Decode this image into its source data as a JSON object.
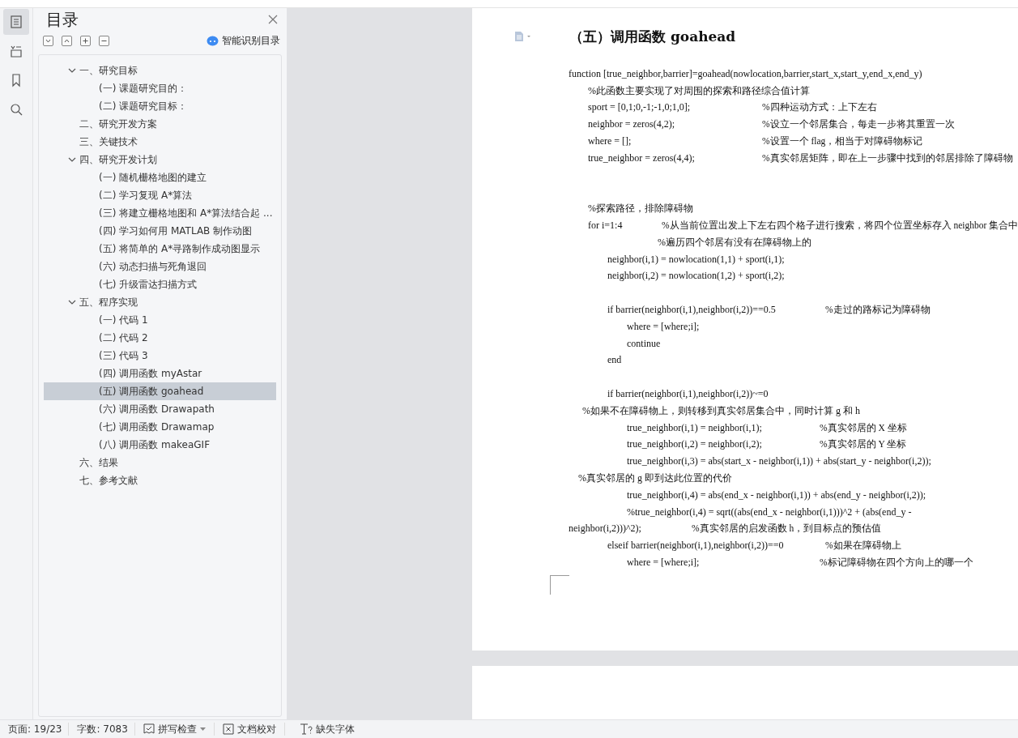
{
  "rail": [
    {
      "kind": "outline",
      "selected": true
    },
    {
      "kind": "pages",
      "selected": false
    },
    {
      "kind": "bookmark",
      "selected": false
    },
    {
      "kind": "search",
      "selected": false
    }
  ],
  "toc": {
    "title": "目录",
    "smart_label": "智能识别目录",
    "items": [
      {
        "label": "一、研究目标",
        "expanded": true,
        "selected": false,
        "children": [
          {
            "label": "(一) 课题研究目的：",
            "selected": false
          },
          {
            "label": "(二) 课题研究目标：",
            "selected": false
          }
        ]
      },
      {
        "label": "二、研究开发方案",
        "selected": false
      },
      {
        "label": "三、关键技术",
        "selected": false
      },
      {
        "label": "四、研究开发计划",
        "expanded": true,
        "selected": false,
        "children": [
          {
            "label": "(一) 随机栅格地图的建立",
            "selected": false
          },
          {
            "label": "(二) 学习复现 A*算法",
            "selected": false
          },
          {
            "label": "(三) 将建立栅格地图和 A*算法结合起 ...",
            "selected": false
          },
          {
            "label": "(四) 学习如何用 MATLAB 制作动图",
            "selected": false
          },
          {
            "label": "(五) 将简单的 A*寻路制作成动图显示",
            "selected": false
          },
          {
            "label": "(六) 动态扫描与死角退回",
            "selected": false
          },
          {
            "label": "(七) 升级雷达扫描方式",
            "selected": false
          }
        ]
      },
      {
        "label": "五、程序实现",
        "expanded": true,
        "selected": false,
        "children": [
          {
            "label": "(一) 代码 1",
            "selected": false
          },
          {
            "label": "(二) 代码 2",
            "selected": false
          },
          {
            "label": "(三) 代码 3",
            "selected": false
          },
          {
            "label": "(四) 调用函数 myAstar",
            "selected": false
          },
          {
            "label": "(五) 调用函数 goahead",
            "selected": true
          },
          {
            "label": "(六) 调用函数 Drawapath",
            "selected": false
          },
          {
            "label": "(七) 调用函数 Drawamap",
            "selected": false
          },
          {
            "label": "(八) 调用函数 makeaGIF",
            "selected": false
          }
        ]
      },
      {
        "label": "六、结果",
        "selected": false
      },
      {
        "label": "七、参考文献",
        "selected": false
      }
    ]
  },
  "document": {
    "heading": "（五）调用函数 goahead",
    "lines": [
      {
        "kind": "signature",
        "code": "function [true_neighbor,barrier]=goahead(nowlocation,barrier,start_x,start_y,end_x,end_y)"
      },
      {
        "kind": "statement",
        "code": "%此函数主要实现了对周围的探索和路径综合值计算"
      },
      {
        "kind": "statement",
        "code": "sport = [0,1;0,-1;-1,0;1,0];",
        "comment": "%四种运动方式：上下左右"
      },
      {
        "kind": "statement",
        "code": "neighbor = zeros(4,2);",
        "comment": "%设立一个邻居集合，每走一步将其重置一次"
      },
      {
        "kind": "statement",
        "code": "where = [];",
        "comment": "%设置一个 flag，相当于对障碍物标记"
      },
      {
        "kind": "statement",
        "code": "true_neighbor = zeros(4,4);",
        "comment": "%真实邻居矩阵，即在上一步骤中找到的邻居排除了障碍物"
      },
      {
        "kind": "blank"
      },
      {
        "kind": "blank"
      },
      {
        "kind": "statement",
        "code": "%探索路径，排除障碍物"
      },
      {
        "kind": "loop",
        "code": "for i=1:4",
        "comment": "%从当前位置出发上下左右四个格子进行搜索，将四个位置坐标存入 neighbor 集合中"
      },
      {
        "kind": "loop-note",
        "code": "%遍历四个邻居有没有在障碍物上的"
      },
      {
        "kind": "inner",
        "code": "neighbor(i,1) = nowlocation(1,1) + sport(i,1);"
      },
      {
        "kind": "inner",
        "code": "neighbor(i,2) = nowlocation(1,2) + sport(i,2);"
      },
      {
        "kind": "blank"
      },
      {
        "kind": "inner",
        "code": "if barrier(neighbor(i,1),neighbor(i,2))==0.5",
        "comment": "%走过的路标记为障碍物"
      },
      {
        "kind": "deep",
        "code": "where = [where;i];"
      },
      {
        "kind": "deep",
        "code": "continue"
      },
      {
        "kind": "inner",
        "code": "end"
      },
      {
        "kind": "blank"
      },
      {
        "kind": "inner",
        "code": "if barrier(neighbor(i,1),neighbor(i,2))~=0"
      },
      {
        "kind": "note-mid",
        "code": "%如果不在障碍物上，则转移到真实邻居集合中，同时计算 g 和 h"
      },
      {
        "kind": "deep",
        "code": "true_neighbor(i,1) = neighbor(i,1);",
        "comment": "%真实邻居的 X 坐标"
      },
      {
        "kind": "deep",
        "code": "true_neighbor(i,2) = neighbor(i,2);",
        "comment": "%真实邻居的 Y 坐标"
      },
      {
        "kind": "deep",
        "code": "true_neighbor(i,3) = abs(start_x - neighbor(i,1)) +    abs(start_y - neighbor(i,2));"
      },
      {
        "kind": "note-left",
        "code": "%真实邻居的 g 即到达此位置的代价"
      },
      {
        "kind": "deep",
        "code": "true_neighbor(i,4) = abs(end_x - neighbor(i,1))     +    abs(end_y - neighbor(i,2));"
      },
      {
        "kind": "wrapped",
        "code": "%true_neighbor(i,4)    =    sqrt((abs(end_x  -  neighbor(i,1)))^2       +       (abs(end_y  -"
      },
      {
        "kind": "continuation",
        "code": "neighbor(i,2)))^2);",
        "comment": "%真实邻居的启发函数 h，到目标点的预估值"
      },
      {
        "kind": "inner",
        "code": "elseif barrier(neighbor(i,1),neighbor(i,2))==0",
        "comment": "%如果在障碍物上"
      },
      {
        "kind": "deep",
        "code": "where = [where;i];",
        "comment": "%标记障碍物在四个方向上的哪一个"
      }
    ]
  },
  "status_bar": {
    "page": "页面: 19/23",
    "words": "字数: 7083",
    "spell": "拼写检查",
    "proof": "文档校对",
    "fonts": "缺失字体"
  }
}
